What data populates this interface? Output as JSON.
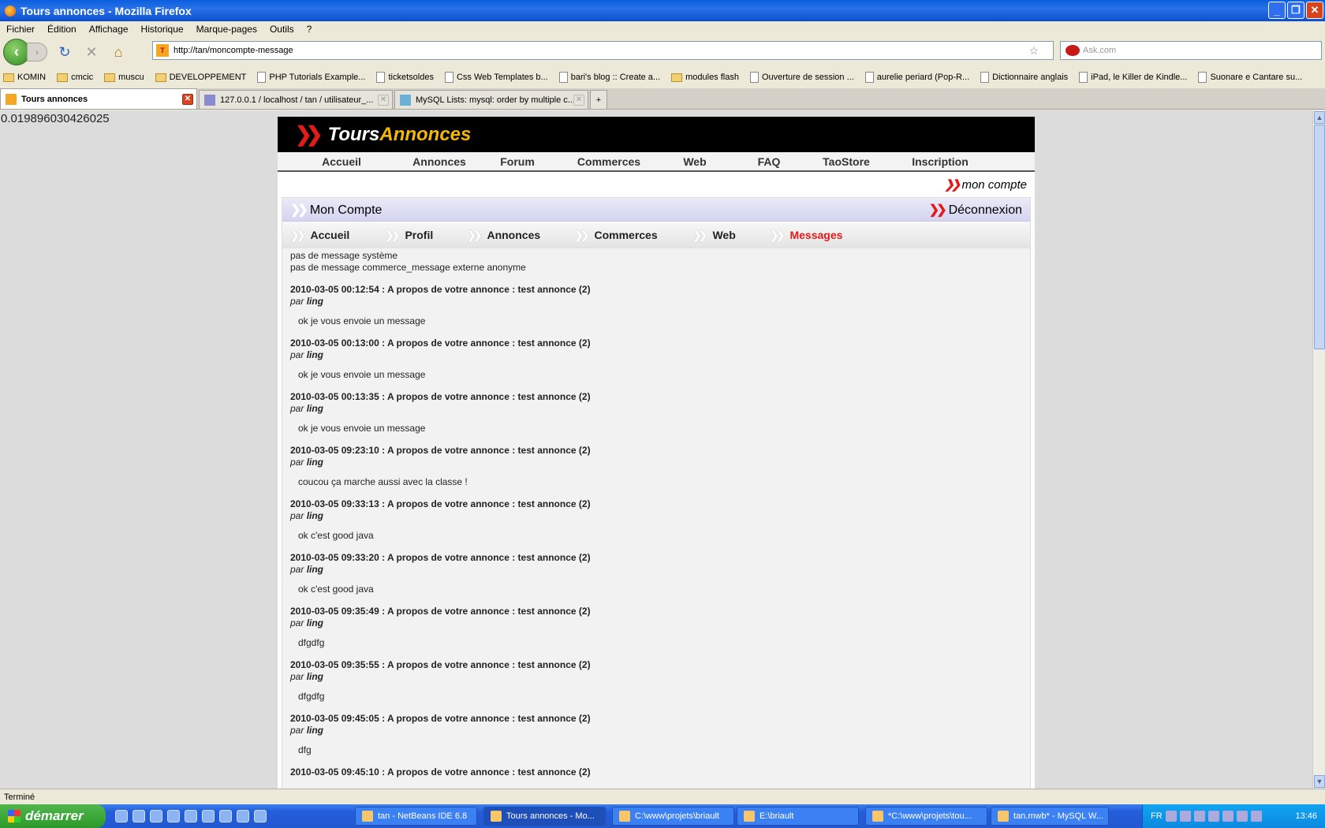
{
  "window": {
    "title": "Tours annonces - Mozilla Firefox"
  },
  "menu": [
    "Fichier",
    "Édition",
    "Affichage",
    "Historique",
    "Marque-pages",
    "Outils",
    "?"
  ],
  "nav": {
    "url": "http://tan/moncompte-message",
    "search_placeholder": "Ask.com"
  },
  "bookmarks": [
    {
      "label": "KOMIN",
      "icon": "folder-icon"
    },
    {
      "label": "cmcic",
      "icon": "folder-icon"
    },
    {
      "label": "muscu",
      "icon": "folder-icon"
    },
    {
      "label": "DEVELOPPEMENT",
      "icon": "folder-icon"
    },
    {
      "label": "PHP Tutorials Example...",
      "icon": "page-icon"
    },
    {
      "label": "ticketsoldes",
      "icon": "page-icon"
    },
    {
      "label": "Css Web Templates b...",
      "icon": "page-icon"
    },
    {
      "label": "bari's blog :: Create a...",
      "icon": "page-icon"
    },
    {
      "label": "modules flash",
      "icon": "folder-icon"
    },
    {
      "label": "Ouverture de session ...",
      "icon": "yahoo-icon"
    },
    {
      "label": "aurelie periard (Pop-R...",
      "icon": "page-icon"
    },
    {
      "label": "Dictionnaire anglais",
      "icon": "wr-icon"
    },
    {
      "label": "iPad, le Killer de Kindle...",
      "icon": "page-icon"
    },
    {
      "label": "Suonare e Cantare su...",
      "icon": "page-icon"
    }
  ],
  "tabs": [
    {
      "label": "Tours annonces",
      "active": true
    },
    {
      "label": "127.0.0.1 / localhost / tan / utilisateur_...",
      "active": false
    },
    {
      "label": "MySQL Lists: mysql: order by multiple c...",
      "active": false
    }
  ],
  "page": {
    "timer": "0.019896030426025",
    "logo": {
      "part1": "Tours",
      "part2": "Annonces"
    },
    "mainnav": [
      "Accueil",
      "Annonces",
      "Forum",
      "Commerces",
      "Web",
      "FAQ",
      "TaoStore",
      "Inscription"
    ],
    "mon_compte_link": "mon compte",
    "panel_title": "Mon Compte",
    "logout": "Déconnexion",
    "subnav": [
      "Accueil",
      "Profil",
      "Annonces",
      "Commerces",
      "Web",
      "Messages"
    ],
    "subnav_active": "Messages",
    "system_lines": [
      "pas de message système",
      "pas de message commerce_message externe anonyme"
    ],
    "messages": [
      {
        "header": "2010-03-05 00:12:54 : A propos de votre annonce : test annonce (2)",
        "par": "par",
        "author": "ling",
        "body": "ok je vous envoie un message"
      },
      {
        "header": "2010-03-05 00:13:00 : A propos de votre annonce : test annonce (2)",
        "par": "par",
        "author": "ling",
        "body": "ok je vous envoie un message"
      },
      {
        "header": "2010-03-05 00:13:35 : A propos de votre annonce : test annonce (2)",
        "par": "par",
        "author": "ling",
        "body": "ok je vous envoie un message"
      },
      {
        "header": "2010-03-05 09:23:10 : A propos de votre annonce : test annonce (2)",
        "par": "par",
        "author": "ling",
        "body": "coucou ça marche aussi avec la classe !"
      },
      {
        "header": "2010-03-05 09:33:13 : A propos de votre annonce : test annonce (2)",
        "par": "par",
        "author": "ling",
        "body": "ok c'est good java"
      },
      {
        "header": "2010-03-05 09:33:20 : A propos de votre annonce : test annonce (2)",
        "par": "par",
        "author": "ling",
        "body": "ok c'est good java"
      },
      {
        "header": "2010-03-05 09:35:49 : A propos de votre annonce : test annonce (2)",
        "par": "par",
        "author": "ling",
        "body": "dfgdfg"
      },
      {
        "header": "2010-03-05 09:35:55 : A propos de votre annonce : test annonce (2)",
        "par": "par",
        "author": "ling",
        "body": "dfgdfg"
      },
      {
        "header": "2010-03-05 09:45:05 : A propos de votre annonce : test annonce (2)",
        "par": "par",
        "author": "ling",
        "body": "dfg"
      },
      {
        "header": "2010-03-05 09:45:10 : A propos de votre annonce : test annonce (2)",
        "par": "",
        "author": "",
        "body": ""
      }
    ]
  },
  "status": "Terminé",
  "taskbar": {
    "start": "démarrer",
    "items": [
      {
        "label": "tan - NetBeans IDE 6.8",
        "active": false
      },
      {
        "label": "Tours annonces - Mo...",
        "active": true
      },
      {
        "label": "C:\\www\\projets\\briault",
        "active": false
      },
      {
        "label": "E:\\briault",
        "active": false
      },
      {
        "label": "*C:\\www\\projets\\tou...",
        "active": false
      },
      {
        "label": "tan.mwb* - MySQL W...",
        "active": false
      }
    ],
    "lang": "FR",
    "clock": "13:46"
  }
}
